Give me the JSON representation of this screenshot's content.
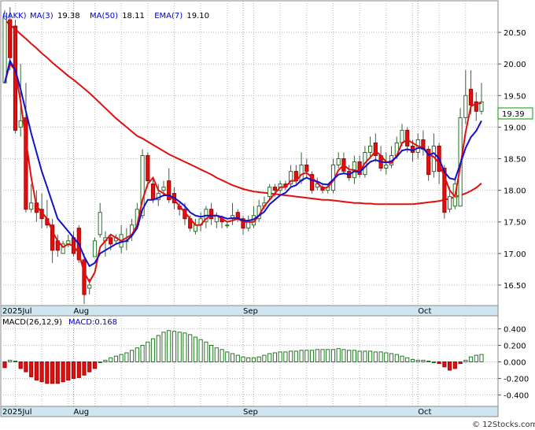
{
  "chart_data": [
    {
      "type": "candlestick",
      "ticker": "(JAKK)",
      "legend": [
        {
          "label": "MA(3)",
          "value": "19.38",
          "color": "#0000cc"
        },
        {
          "label": "MA(50)",
          "value": "18.11",
          "color": "#dd0000"
        },
        {
          "label": "EMA(7)",
          "value": "19.10",
          "color": "#000000"
        }
      ],
      "last_price_label": "19.39",
      "ylim": [
        16.2,
        20.95
      ],
      "y_ticks": [
        "16.50",
        "17.00",
        "17.50",
        "18.00",
        "18.50",
        "19.00",
        "19.50",
        "20.00",
        "20.50"
      ],
      "x_labels": [
        {
          "label": "2025Jul",
          "index": 0
        },
        {
          "label": "Aug",
          "index": 13
        },
        {
          "label": "Sep",
          "index": 45
        },
        {
          "label": "Oct",
          "index": 78
        }
      ],
      "candles": [
        [
          19.7,
          20.75,
          19.7,
          20.85
        ],
        [
          20.7,
          20.1,
          19.9,
          20.9
        ],
        [
          20.6,
          18.95,
          18.9,
          20.7
        ],
        [
          19.0,
          19.1,
          18.85,
          20.0
        ],
        [
          19.15,
          17.7,
          17.65,
          19.7
        ],
        [
          17.7,
          17.8,
          17.65,
          18.1
        ],
        [
          17.8,
          17.65,
          17.5,
          18.0
        ],
        [
          17.7,
          17.55,
          17.4,
          17.95
        ],
        [
          17.55,
          17.45,
          17.4,
          17.85
        ],
        [
          17.45,
          17.05,
          16.85,
          17.55
        ],
        [
          17.2,
          17.05,
          16.95,
          17.3
        ],
        [
          17.0,
          17.15,
          17.05,
          17.2
        ],
        [
          17.15,
          17.2,
          17.1,
          17.3
        ],
        [
          17.25,
          17.0,
          16.95,
          17.35
        ],
        [
          17.4,
          16.9,
          16.85,
          17.45
        ],
        [
          16.9,
          16.35,
          16.2,
          17.0
        ],
        [
          16.45,
          16.5,
          16.35,
          16.6
        ],
        [
          16.95,
          17.2,
          17.1,
          17.25
        ],
        [
          17.3,
          17.65,
          17.25,
          17.8
        ],
        [
          17.2,
          17.25,
          16.95,
          17.35
        ],
        [
          17.25,
          17.15,
          17.05,
          17.3
        ],
        [
          17.2,
          17.25,
          17.15,
          17.3
        ],
        [
          17.1,
          17.3,
          17.0,
          17.45
        ],
        [
          17.2,
          17.2,
          17.05,
          17.4
        ],
        [
          17.3,
          17.45,
          17.2,
          17.55
        ],
        [
          17.45,
          17.7,
          17.4,
          17.8
        ],
        [
          17.6,
          18.55,
          17.55,
          18.65
        ],
        [
          18.55,
          18.15,
          18.05,
          18.6
        ],
        [
          18.1,
          17.85,
          17.8,
          18.2
        ],
        [
          17.85,
          17.95,
          17.75,
          18.1
        ],
        [
          18.0,
          18.05,
          17.9,
          18.15
        ],
        [
          18.15,
          17.85,
          17.8,
          18.35
        ],
        [
          17.95,
          17.8,
          17.7,
          18.05
        ],
        [
          17.75,
          17.7,
          17.6,
          17.8
        ],
        [
          17.7,
          17.55,
          17.45,
          17.8
        ],
        [
          17.55,
          17.4,
          17.35,
          17.6
        ],
        [
          17.35,
          17.45,
          17.3,
          17.55
        ],
        [
          17.45,
          17.55,
          17.35,
          17.65
        ],
        [
          17.5,
          17.7,
          17.4,
          17.75
        ],
        [
          17.7,
          17.55,
          17.45,
          17.8
        ],
        [
          17.5,
          17.6,
          17.4,
          17.65
        ],
        [
          17.55,
          17.5,
          17.4,
          17.6
        ],
        [
          17.45,
          17.45,
          17.4,
          17.5
        ],
        [
          17.55,
          17.6,
          17.45,
          17.8
        ],
        [
          17.65,
          17.55,
          17.5,
          17.7
        ],
        [
          17.55,
          17.4,
          17.3,
          17.6
        ],
        [
          17.4,
          17.5,
          17.35,
          17.6
        ],
        [
          17.45,
          17.6,
          17.4,
          17.75
        ],
        [
          17.55,
          17.75,
          17.5,
          17.85
        ],
        [
          17.75,
          17.8,
          17.7,
          17.9
        ],
        [
          17.9,
          18.05,
          17.85,
          18.1
        ],
        [
          18.05,
          18.0,
          17.9,
          18.1
        ],
        [
          18.0,
          18.1,
          17.95,
          18.15
        ],
        [
          18.1,
          18.05,
          18.0,
          18.15
        ],
        [
          18.1,
          18.3,
          18.05,
          18.4
        ],
        [
          18.3,
          18.15,
          18.1,
          18.4
        ],
        [
          18.15,
          18.4,
          18.1,
          18.6
        ],
        [
          18.4,
          18.3,
          18.2,
          18.5
        ],
        [
          18.25,
          18.0,
          17.95,
          18.3
        ],
        [
          18.05,
          18.1,
          18.0,
          18.2
        ],
        [
          18.05,
          18.0,
          17.95,
          18.1
        ],
        [
          18.0,
          18.05,
          17.95,
          18.1
        ],
        [
          18.0,
          18.4,
          17.95,
          18.5
        ],
        [
          18.4,
          18.5,
          18.35,
          18.6
        ],
        [
          18.5,
          18.3,
          18.25,
          18.6
        ],
        [
          18.3,
          18.2,
          18.15,
          18.4
        ],
        [
          18.2,
          18.45,
          18.1,
          18.55
        ],
        [
          18.45,
          18.25,
          18.2,
          18.55
        ],
        [
          18.25,
          18.6,
          18.2,
          18.7
        ],
        [
          18.6,
          18.7,
          18.5,
          18.85
        ],
        [
          18.75,
          18.55,
          18.45,
          18.9
        ],
        [
          18.55,
          18.35,
          18.3,
          18.7
        ],
        [
          18.35,
          18.4,
          18.25,
          18.6
        ],
        [
          18.4,
          18.55,
          18.35,
          18.7
        ],
        [
          18.55,
          18.75,
          18.5,
          18.85
        ],
        [
          18.75,
          18.95,
          18.7,
          19.05
        ],
        [
          18.95,
          18.7,
          18.6,
          19.0
        ],
        [
          18.7,
          18.6,
          18.45,
          18.8
        ],
        [
          18.6,
          18.8,
          18.5,
          18.9
        ],
        [
          18.8,
          18.65,
          18.55,
          18.95
        ],
        [
          18.65,
          18.25,
          18.15,
          18.7
        ],
        [
          18.3,
          18.7,
          18.2,
          18.9
        ],
        [
          18.7,
          18.3,
          18.1,
          18.75
        ],
        [
          18.35,
          17.65,
          17.55,
          18.4
        ],
        [
          17.7,
          17.9,
          17.65,
          18.05
        ],
        [
          17.75,
          18.1,
          17.7,
          18.2
        ],
        [
          17.75,
          19.15,
          17.75,
          19.3
        ],
        [
          19.15,
          19.5,
          19.05,
          19.9
        ],
        [
          19.6,
          19.35,
          19.2,
          19.9
        ],
        [
          19.4,
          19.25,
          19.1,
          19.55
        ],
        [
          19.25,
          19.4,
          19.2,
          19.7
        ]
      ],
      "ma3": [
        19.7,
        20.0,
        19.9,
        19.4,
        18.8,
        18.2,
        17.75,
        17.65,
        17.55,
        17.35,
        17.2,
        17.1,
        17.15,
        17.12,
        17.0,
        16.7,
        16.55,
        16.7,
        17.1,
        17.2,
        17.3,
        17.25,
        17.2,
        17.25,
        17.3,
        17.45,
        17.85,
        18.1,
        18.2,
        18.0,
        17.95,
        17.9,
        17.85,
        17.75,
        17.65,
        17.55,
        17.45,
        17.45,
        17.55,
        17.6,
        17.6,
        17.55,
        17.5,
        17.52,
        17.55,
        17.5,
        17.5,
        17.5,
        17.6,
        17.75,
        17.85,
        17.95,
        18.05,
        18.05,
        18.15,
        18.15,
        18.25,
        18.28,
        18.2,
        18.12,
        18.03,
        18.05,
        18.15,
        18.32,
        18.4,
        18.33,
        18.32,
        18.3,
        18.43,
        18.52,
        18.62,
        18.55,
        18.45,
        18.43,
        18.55,
        18.75,
        18.8,
        18.75,
        18.7,
        18.68,
        18.57,
        18.53,
        18.42,
        18.22,
        18.0,
        17.9,
        18.38,
        18.92,
        19.33,
        19.37,
        19.38
      ],
      "ma50": [
        20.7,
        20.62,
        20.55,
        20.47,
        20.4,
        20.32,
        20.25,
        20.17,
        20.1,
        20.02,
        19.95,
        19.88,
        19.81,
        19.75,
        19.68,
        19.61,
        19.54,
        19.46,
        19.38,
        19.3,
        19.22,
        19.14,
        19.07,
        19.0,
        18.93,
        18.86,
        18.82,
        18.77,
        18.72,
        18.67,
        18.62,
        18.57,
        18.53,
        18.49,
        18.45,
        18.41,
        18.37,
        18.33,
        18.29,
        18.25,
        18.2,
        18.16,
        18.12,
        18.08,
        18.05,
        18.02,
        18.0,
        17.98,
        17.97,
        17.96,
        17.95,
        17.94,
        17.93,
        17.92,
        17.91,
        17.9,
        17.89,
        17.88,
        17.87,
        17.86,
        17.85,
        17.85,
        17.84,
        17.83,
        17.82,
        17.81,
        17.8,
        17.8,
        17.79,
        17.79,
        17.78,
        17.78,
        17.78,
        17.78,
        17.78,
        17.78,
        17.78,
        17.78,
        17.79,
        17.8,
        17.81,
        17.82,
        17.83,
        17.85,
        17.87,
        17.89,
        17.92,
        17.95,
        17.99,
        18.04,
        18.11
      ],
      "ema7": [
        19.7,
        20.05,
        19.9,
        19.6,
        19.25,
        18.9,
        18.6,
        18.3,
        18.05,
        17.8,
        17.55,
        17.45,
        17.35,
        17.25,
        17.15,
        16.95,
        16.8,
        16.85,
        17.0,
        17.05,
        17.1,
        17.15,
        17.18,
        17.2,
        17.28,
        17.4,
        17.7,
        17.85,
        17.85,
        17.88,
        17.92,
        17.92,
        17.88,
        17.82,
        17.75,
        17.65,
        17.6,
        17.58,
        17.6,
        17.6,
        17.6,
        17.58,
        17.55,
        17.56,
        17.56,
        17.52,
        17.52,
        17.54,
        17.6,
        17.66,
        17.78,
        17.85,
        17.92,
        17.96,
        18.05,
        18.08,
        18.16,
        18.2,
        18.16,
        18.14,
        18.1,
        18.09,
        18.17,
        18.25,
        18.27,
        18.25,
        18.3,
        18.29,
        18.37,
        18.45,
        18.48,
        18.45,
        18.44,
        18.46,
        18.53,
        18.63,
        18.65,
        18.63,
        18.67,
        18.67,
        18.56,
        18.59,
        18.5,
        18.29,
        18.19,
        18.17,
        18.42,
        18.67,
        18.84,
        18.94,
        19.1
      ]
    },
    {
      "type": "bar",
      "title": "MACD(26,12,9)",
      "legend": [
        {
          "label": "MACD:0.168",
          "color": "#0000cc"
        }
      ],
      "ylim": [
        -0.52,
        0.52
      ],
      "y_ticks": [
        "0.400",
        "0.200",
        "0.000",
        "-0.200",
        "-0.400"
      ],
      "x_labels": [
        {
          "label": "2025Jul",
          "index": 0
        },
        {
          "label": "Aug",
          "index": 13
        },
        {
          "label": "Sep",
          "index": 45
        },
        {
          "label": "Oct",
          "index": 78
        }
      ],
      "values": [
        -0.07,
        0.02,
        0.01,
        -0.08,
        -0.12,
        -0.18,
        -0.22,
        -0.24,
        -0.26,
        -0.26,
        -0.26,
        -0.24,
        -0.22,
        -0.2,
        -0.19,
        -0.16,
        -0.12,
        -0.08,
        0.0,
        0.02,
        0.05,
        0.07,
        0.09,
        0.11,
        0.14,
        0.17,
        0.2,
        0.24,
        0.28,
        0.32,
        0.36,
        0.38,
        0.37,
        0.36,
        0.35,
        0.33,
        0.3,
        0.27,
        0.24,
        0.2,
        0.17,
        0.15,
        0.12,
        0.1,
        0.08,
        0.06,
        0.05,
        0.05,
        0.06,
        0.08,
        0.1,
        0.11,
        0.12,
        0.12,
        0.13,
        0.13,
        0.14,
        0.14,
        0.14,
        0.15,
        0.15,
        0.15,
        0.15,
        0.16,
        0.15,
        0.14,
        0.14,
        0.13,
        0.13,
        0.13,
        0.12,
        0.12,
        0.11,
        0.1,
        0.09,
        0.07,
        0.05,
        0.03,
        0.02,
        0.02,
        0.01,
        0.0,
        -0.02,
        -0.06,
        -0.1,
        -0.08,
        -0.02,
        0.02,
        0.06,
        0.08,
        0.09
      ]
    }
  ],
  "footer": "© 12Stocks.com"
}
